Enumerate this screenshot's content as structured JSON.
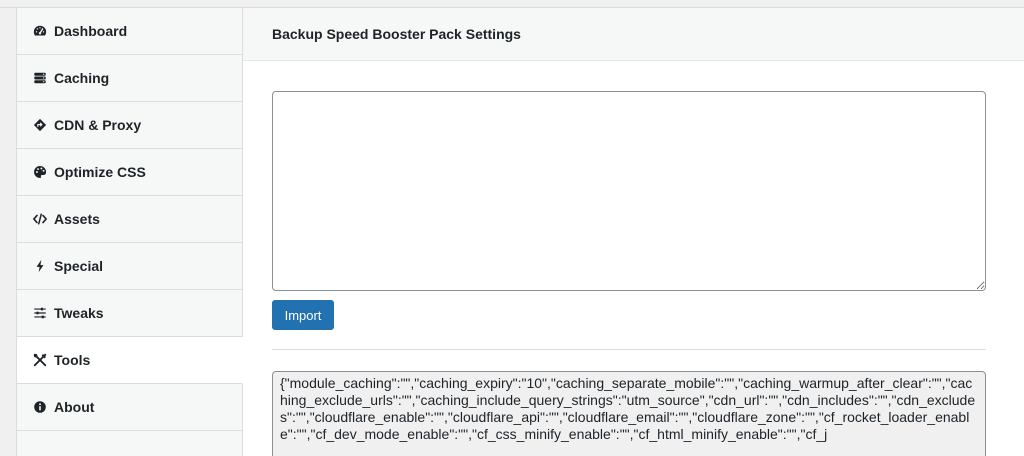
{
  "sidebar": {
    "items": [
      {
        "label": "Dashboard",
        "icon": "dashboard-icon"
      },
      {
        "label": "Caching",
        "icon": "database-icon"
      },
      {
        "label": "CDN & Proxy",
        "icon": "cdn-icon"
      },
      {
        "label": "Optimize CSS",
        "icon": "palette-icon"
      },
      {
        "label": "Assets",
        "icon": "code-icon"
      },
      {
        "label": "Special",
        "icon": "bolt-icon"
      },
      {
        "label": "Tweaks",
        "icon": "sliders-icon"
      },
      {
        "label": "Tools",
        "icon": "tools-icon",
        "active": true
      },
      {
        "label": "About",
        "icon": "info-icon"
      }
    ]
  },
  "main": {
    "title": "Backup Speed Booster Pack Settings",
    "import_value": "",
    "import_button": "Import",
    "export_value": "{\"module_caching\":\"\",\"caching_expiry\":\"10\",\"caching_separate_mobile\":\"\",\"caching_warmup_after_clear\":\"\",\"caching_exclude_urls\":\"\",\"caching_include_query_strings\":\"utm_source\",\"cdn_url\":\"\",\"cdn_includes\":\"\",\"cdn_excludes\":\"\",\"cloudflare_enable\":\"\",\"cloudflare_api\":\"\",\"cloudflare_email\":\"\",\"cloudflare_zone\":\"\",\"cf_rocket_loader_enable\":\"\",\"cf_dev_mode_enable\":\"\",\"cf_css_minify_enable\":\"\",\"cf_html_minify_enable\":\"\",\"cf_j"
  },
  "colors": {
    "primary_button": "#2271b1",
    "sidebar_bg": "#f6f7f7",
    "border": "#dcdcde"
  }
}
